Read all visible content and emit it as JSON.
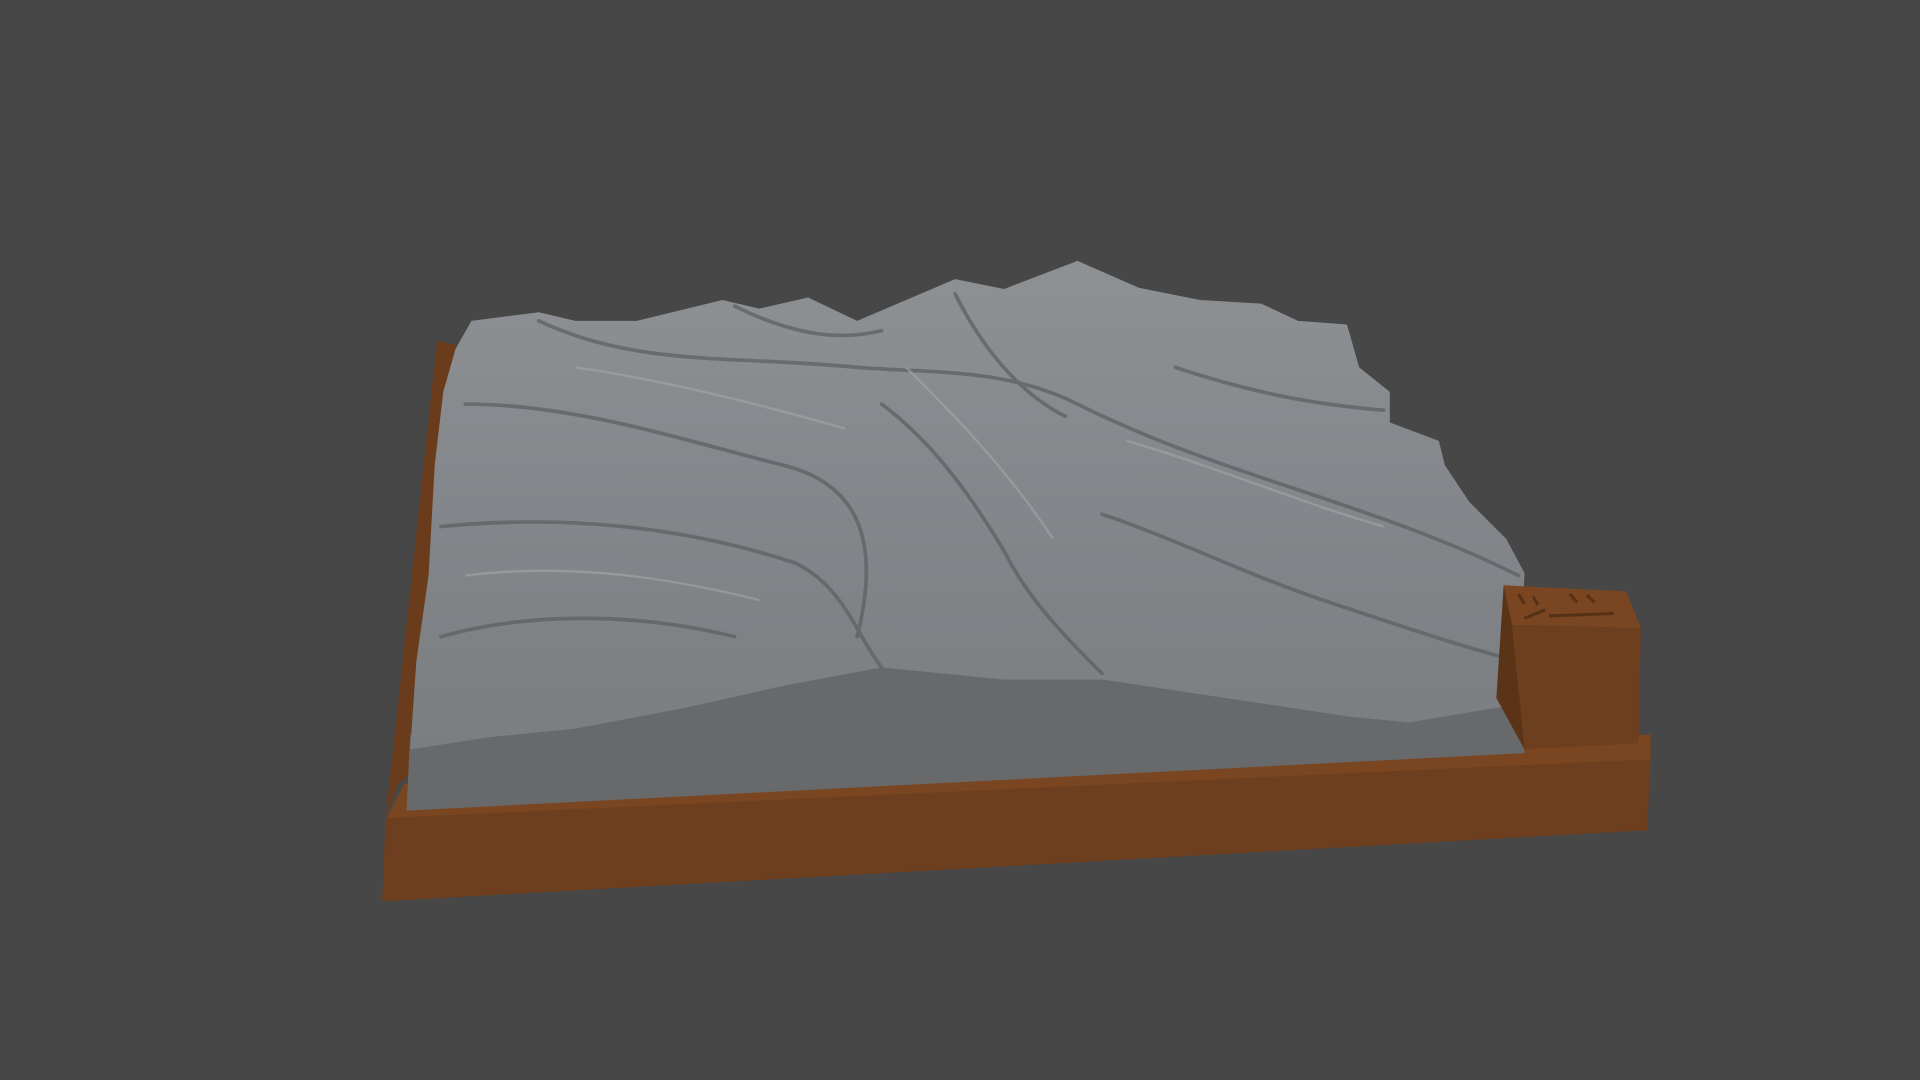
{
  "scene": {
    "subject": "terrain-relief-model",
    "colors": {
      "background": "#474747",
      "terrain": "#8a8d90",
      "terrain_shadow": "#5c5f62",
      "slab": "#6a6c6e",
      "base": "#6e3f1e",
      "base_dark": "#5b3417",
      "base_light": "#7c4822"
    }
  }
}
